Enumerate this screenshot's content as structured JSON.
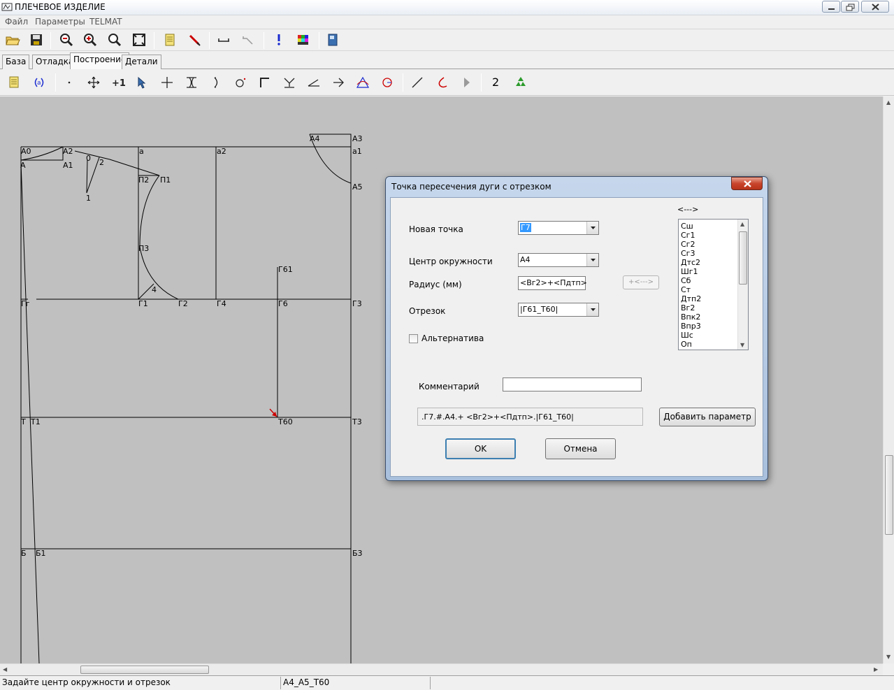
{
  "window": {
    "title": "ПЛЕЧЕВОЕ ИЗДЕЛИЕ"
  },
  "menu": [
    "Файл",
    "Параметры",
    "TELMAT"
  ],
  "toolbar_top": [
    {
      "name": "open-folder-icon"
    },
    {
      "name": "save-icon"
    },
    {
      "name": "zoom-out-icon"
    },
    {
      "name": "zoom-in-icon"
    },
    {
      "name": "zoom-icon"
    },
    {
      "name": "fit-window-icon"
    },
    {
      "name": "notes-icon"
    },
    {
      "name": "pen-tool-icon"
    },
    {
      "name": "ruler-icon"
    },
    {
      "name": "measure-disabled-icon"
    },
    {
      "name": "exclamation-icon"
    },
    {
      "name": "palette-icon"
    },
    {
      "name": "book-icon"
    }
  ],
  "tabs": [
    {
      "label": "База",
      "active": false
    },
    {
      "label": "Отладка",
      "active": false
    },
    {
      "label": "Построение",
      "active": true
    },
    {
      "label": "Детали",
      "active": false
    }
  ],
  "toolbar_build": {
    "counter_label": "2"
  },
  "canvas": {
    "points": [
      "А0",
      "А2",
      "А",
      "А1",
      "0",
      "2",
      "1",
      "а",
      "а2",
      "а1",
      "А4",
      "А3",
      "А5",
      "П2",
      "П1",
      "П3",
      "Г61",
      "Гг",
      "Г1",
      "4",
      "Г2",
      "Г4",
      "Г6",
      "Г3",
      "Т",
      "Т1",
      "Т60",
      "Т3",
      "Б",
      "Б1",
      "Б3"
    ]
  },
  "status": {
    "hint": "Задайте центр окружности и отрезок",
    "selection": "А4_А5_Т60"
  },
  "dialog": {
    "title": "Точка пересечения дуги с отрезком",
    "new_point_label": "Новая точка",
    "new_point_value": "Г7",
    "center_label": "Центр окружности",
    "center_value": "А4",
    "radius_label": "Радиус (мм)",
    "radius_value": "<Вг2>+<Пдтп>",
    "insert_param_button": "+<--->",
    "segment_label": "Отрезок",
    "segment_value": "|Г61_Т60|",
    "alt_label": "Альтернатива",
    "alt_checked": false,
    "comment_label": "Комментарий",
    "comment_value": "",
    "formula": ".Г7.#.А4.+ <Вг2>+<Пдтп>.|Г61_Т60|",
    "add_param_button": "Добавить параметр",
    "ok_button": "OK",
    "cancel_button": "Отмена",
    "param_header": "<--->",
    "params": [
      "Сш",
      "Сг1",
      "Сг2",
      "Сг3",
      "Дтс2",
      "Шг1",
      "Сб",
      "Ст",
      "Дтп2",
      "Вг2",
      "Впк2",
      "Впр3",
      "Шс",
      "Оп"
    ]
  }
}
